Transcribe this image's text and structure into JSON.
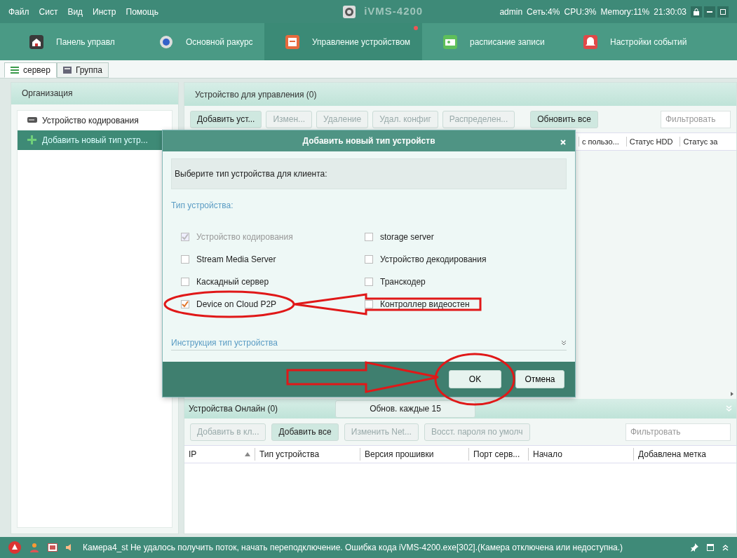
{
  "menu": [
    "Файл",
    "Сист",
    "Вид",
    "Инстр",
    "Помощь"
  ],
  "app_title": "iVMS-4200",
  "status_info": [
    "admin",
    "Сеть:4%",
    "CPU:3%",
    "Memory:11%",
    "21:30:03"
  ],
  "tabs": [
    {
      "label": "Панель управл",
      "selected": false,
      "kind": "home"
    },
    {
      "label": "Основной ракурс",
      "selected": false,
      "kind": "camera"
    },
    {
      "label": "Управление устройством",
      "selected": true,
      "kind": "device"
    },
    {
      "label": "расписание записи",
      "selected": false,
      "kind": "schedule"
    },
    {
      "label": "Настройки событий",
      "selected": false,
      "kind": "alarm"
    }
  ],
  "subtabs": [
    {
      "label": "сервер",
      "selected": true,
      "kind": "list"
    },
    {
      "label": "Группа",
      "selected": false,
      "kind": "group"
    }
  ],
  "organization": {
    "title": "Организация",
    "items": [
      {
        "label": "Устройство кодирования",
        "selected": false,
        "kind": "device"
      },
      {
        "label": "Добавить новый тип устр...",
        "selected": true,
        "kind": "add"
      }
    ]
  },
  "managed": {
    "title": "Устройство для управления (0)",
    "buttons": [
      {
        "label": "Добавить уст...",
        "disabled": false
      },
      {
        "label": "Измен...",
        "disabled": true
      },
      {
        "label": "Удаление",
        "disabled": true
      },
      {
        "label": "Удал. конфиг",
        "disabled": true
      },
      {
        "label": "Распределен...",
        "disabled": true
      }
    ],
    "refresh_button": "Обновить все",
    "filter_placeholder": "Фильтровать",
    "columns": [
      "с пользо...",
      "Статус HDD",
      "Статус за"
    ]
  },
  "online": {
    "title": "Устройства Онлайн (0)",
    "refresh_button": "Обнов. каждые 15",
    "buttons": [
      {
        "label": "Добавить в кл...",
        "disabled": true
      },
      {
        "label": "Добавить все",
        "disabled": false
      },
      {
        "label": "Изменить Net...",
        "disabled": true
      },
      {
        "label": "Восст. пароля по умолч",
        "disabled": true
      }
    ],
    "filter_placeholder": "Фильтровать",
    "columns": [
      {
        "label": "IP",
        "sorted": true
      },
      {
        "label": "Тип устройства"
      },
      {
        "label": "Версия прошивки"
      },
      {
        "label": "Порт серв..."
      },
      {
        "label": "Начало"
      },
      {
        "label": "Добавлена метка"
      }
    ]
  },
  "dialog": {
    "title": "Добавить новый тип устройств",
    "prompt": "Выберите тип устройства для клиента:",
    "section_label": "Тип устройства:",
    "options": [
      {
        "label": "Устройство кодирования",
        "checked": true,
        "disabled": true
      },
      {
        "label": "storage server",
        "checked": false,
        "disabled": false
      },
      {
        "label": "Stream Media Server",
        "checked": false,
        "disabled": false
      },
      {
        "label": "Устройство декодирования",
        "checked": false,
        "disabled": false
      },
      {
        "label": "Каскадный сервер",
        "checked": false,
        "disabled": false
      },
      {
        "label": "Транскодер",
        "checked": false,
        "disabled": false
      },
      {
        "label": "Device on Cloud P2P",
        "checked": true,
        "disabled": false
      },
      {
        "label": "Контроллер видеостен",
        "checked": false,
        "disabled": false
      }
    ],
    "instruction": "Инструкция тип устройства",
    "expanded": false,
    "ok": "OK",
    "cancel": "Отмена"
  },
  "status_bar": {
    "message": "Камера4_st Не удалось получить поток, начать переподключение. Ошибка кода iVMS-4200.exe[302].(Камера отключена или недоступна.)"
  }
}
